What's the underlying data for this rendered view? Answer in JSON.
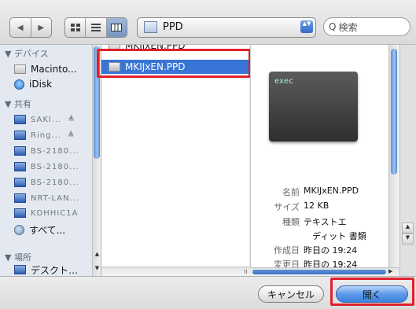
{
  "toolbar": {
    "back_glyph": "◀",
    "forward_glyph": "▶",
    "view_modes": [
      "icon-view",
      "list-view",
      "column-view"
    ],
    "path_popup_value": "PPD",
    "path_popup_arrows": "▲▼",
    "search_placeholder": "検索",
    "search_glyph": "Q"
  },
  "sidebar": {
    "sections": {
      "devices": "▼ デバイス",
      "shared": "▼ 共有",
      "places": "▼ 場所"
    },
    "devices": [
      {
        "label": "Macinto...",
        "icon": "hard-disk-icon"
      },
      {
        "label": "iDisk",
        "icon": "idisk-icon"
      }
    ],
    "shared": [
      {
        "label": "SAKI...",
        "icon": "computer-icon",
        "eject": "≜"
      },
      {
        "label": "Ring...",
        "icon": "computer-icon",
        "eject": "≜"
      },
      {
        "label": "BS-2180...",
        "icon": "computer-icon"
      },
      {
        "label": "BS-2180...",
        "icon": "computer-icon"
      },
      {
        "label": "BS-2180...",
        "icon": "computer-icon"
      },
      {
        "label": "NRT-LAN...",
        "icon": "computer-icon"
      },
      {
        "label": "KDHHIC1A",
        "icon": "computer-icon"
      },
      {
        "label": "すべて...",
        "icon": "network-globe-icon"
      }
    ],
    "places": [
      {
        "label": "デスクト…",
        "icon": "desktop-icon"
      }
    ]
  },
  "files": {
    "clipped_item": "MKIJxEN.PPD",
    "selected_item": "MKIJxEN.PPD"
  },
  "preview": {
    "icon_text": "exec",
    "info": [
      {
        "label": "名前",
        "value": "MKIJxEN.PPD"
      },
      {
        "label": "サイズ",
        "value": "12 KB"
      },
      {
        "label": "種類",
        "value": "テキストエ"
      },
      {
        "label": "",
        "value": "ディット 書類"
      },
      {
        "label": "作成日",
        "value": "昨日の 19:24"
      },
      {
        "label": "変更日",
        "value": "昨日の 19:24"
      }
    ]
  },
  "buttons": {
    "cancel": "キャンセル",
    "open": "開く"
  },
  "colors": {
    "selection": "#3875d7",
    "highlight_box": "#e0202c",
    "default_button": "#5d9ae9"
  }
}
